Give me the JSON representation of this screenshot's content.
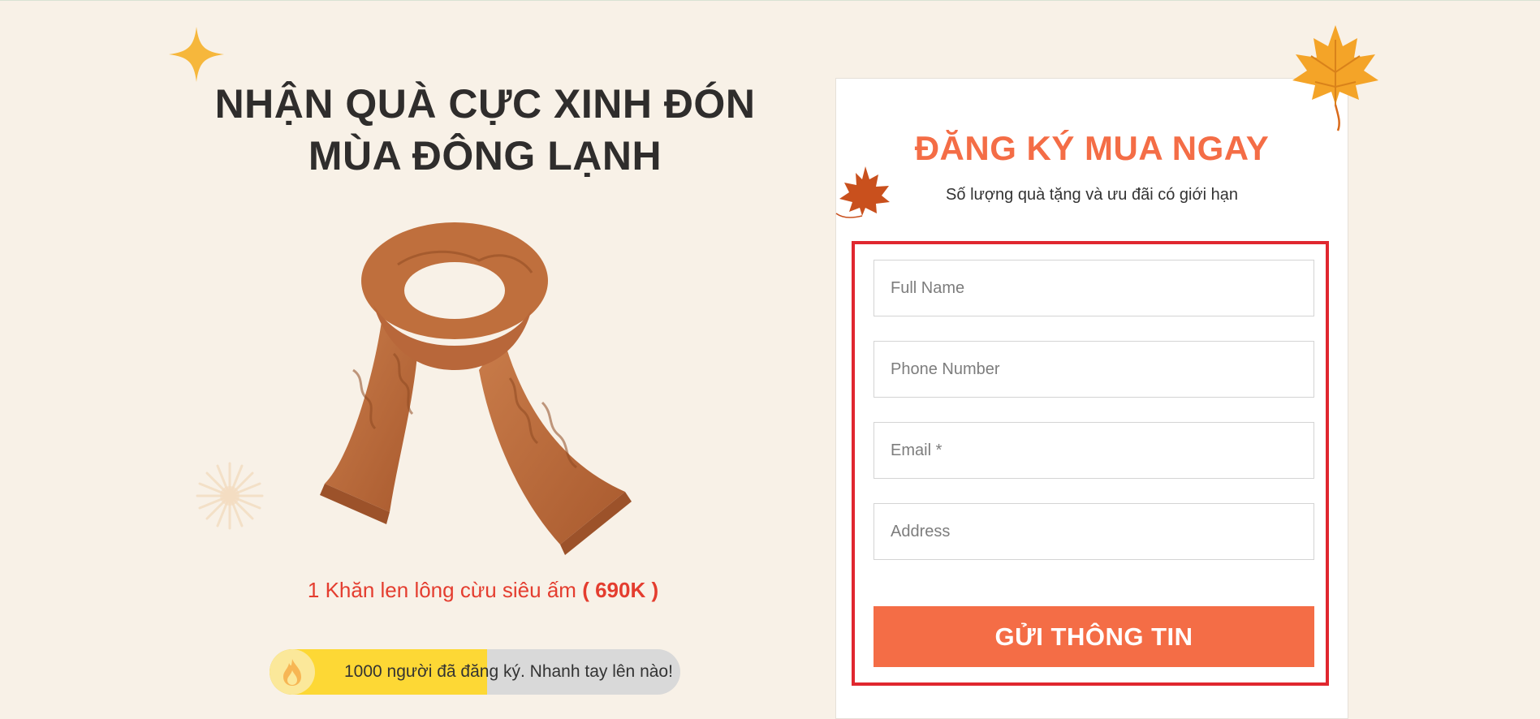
{
  "hero": {
    "title_line1": "NHẬN QUÀ CỰC XINH ĐÓN",
    "title_line2": "MÙA ĐÔNG LẠNH",
    "product_name": "1 Khăn len lông cừu siêu ấm",
    "product_price": "( 690K )"
  },
  "progress": {
    "text": "1000 người đã đăng ký. Nhanh tay lên nào!",
    "fill_fraction": 0.53,
    "fill_color": "#fdd835",
    "track_color": "#d9d9d9"
  },
  "form": {
    "title": "ĐĂNG KÝ MUA NGAY",
    "subtitle": "Số lượng quà tặng và ưu đãi có giới hạn",
    "fields": {
      "full_name": "Full Name",
      "phone": "Phone Number",
      "email": "Email *",
      "address": "Address"
    },
    "submit_label": "GỬI THÔNG TIN"
  },
  "colors": {
    "background": "#f8f1e7",
    "accent": "#f46d46",
    "price_red": "#e43d2f",
    "frame_red": "#e0272f"
  },
  "icons": [
    "sparkle-star-icon",
    "maple-leaf-icon",
    "fire-icon",
    "scarf-image"
  ]
}
